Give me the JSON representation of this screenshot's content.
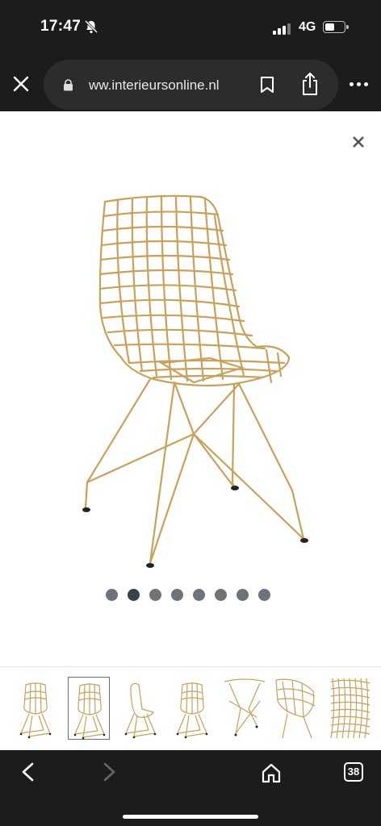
{
  "status": {
    "time": "17:47",
    "network": "4G",
    "signal_bars": 4,
    "signal_active": 3,
    "battery_level": 0.4,
    "icons": [
      "bell-off-icon",
      "signal-icon",
      "battery-icon"
    ]
  },
  "browser": {
    "url": "ww.interieursonline.nl",
    "icons": [
      "close-icon",
      "lock-icon",
      "bookmark-icon",
      "share-icon",
      "more-icon"
    ]
  },
  "gallery": {
    "image_count": 8,
    "active_index": 1,
    "thumbnail_count": 7,
    "selected_thumbnail": 1,
    "colors": {
      "gold": "#c8a15a",
      "dot": "#6e7379",
      "dot_active": "#3b4149"
    }
  },
  "bottom_nav": {
    "tab_count": "38",
    "icons": [
      "back-icon",
      "forward-icon",
      "home-icon",
      "tabs-icon"
    ]
  }
}
